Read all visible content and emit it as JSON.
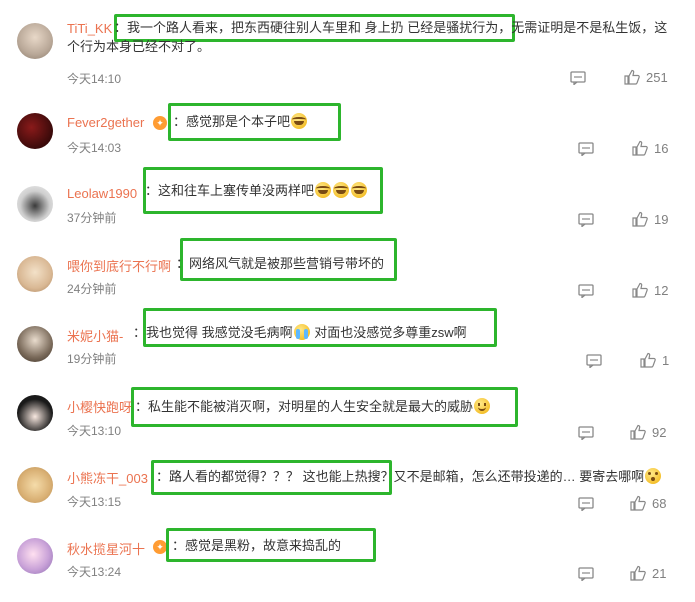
{
  "colors": {
    "name": "#eb7350",
    "text": "#333333",
    "meta": "#808080",
    "highlight": "#2db52d",
    "badge": "#ff9c33"
  },
  "comments": [
    {
      "user": "TiTi_KK",
      "text_main": "：我一个路人看来，把东西硬往别人车里和 身上扔 已经是骚扰行为，",
      "text_tail": "无需证明是不是私生饭，这",
      "text_line2": "个行为本身已经不对了。",
      "time": "今天14:10",
      "likes": "251",
      "avatar_icon": "avatar-photo"
    },
    {
      "user": "Fever2gether",
      "text": "：感觉那是个本子吧",
      "time": "今天14:03",
      "likes": "16",
      "badge": "✦"
    },
    {
      "user": "Leolaw1990",
      "text": "：这和往车上塞传单没两样吧",
      "time": "37分钟前",
      "likes": "19"
    },
    {
      "user": "喂你到底行不行啊",
      "text": "：网络风气就是被那些营销号带坏的",
      "time": "24分钟前",
      "likes": "12"
    },
    {
      "user": "米妮小猫-",
      "text_a": "：我也觉得 我感觉没毛病啊",
      "text_b": " 对面也没感觉多尊重zsw啊",
      "time": "19分钟前",
      "likes": "1"
    },
    {
      "user": "小樱快跑呀",
      "text": "：私生能不能被消灭啊，对明星的人生安全就是最大的威胁",
      "time": "今天13:10",
      "likes": "92"
    },
    {
      "user": "小熊冻干_003",
      "text_main": "：路人看的都觉得？？？ 这也能上热搜？",
      "text_tail": "又不是邮箱，怎么还带投递的… 要寄去哪啊",
      "time": "今天13:15",
      "likes": "68"
    },
    {
      "user": "秋水揽星河十",
      "text": "：感觉是黑粉，故意来捣乱的",
      "time": "今天13:24",
      "likes": "21",
      "badge": "✦"
    }
  ]
}
